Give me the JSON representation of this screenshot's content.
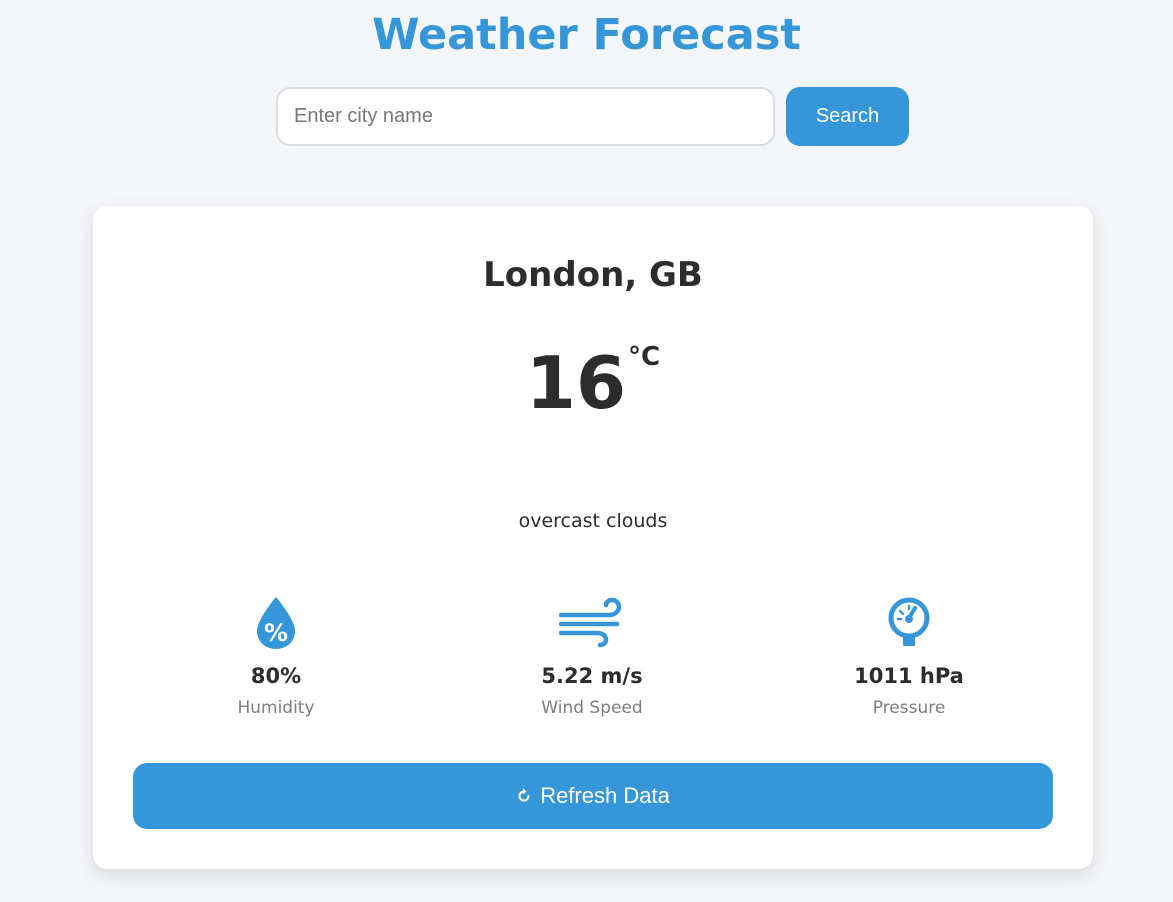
{
  "header": {
    "title": "Weather Forecast"
  },
  "search": {
    "placeholder": "Enter city name",
    "value": "",
    "button_label": "Search"
  },
  "weather": {
    "location": "London, GB",
    "temperature": "16",
    "unit": "°C",
    "description": "overcast clouds"
  },
  "stats": {
    "humidity": {
      "value": "80%",
      "label": "Humidity",
      "icon": "humidity-icon"
    },
    "wind": {
      "value": "5.22 m/s",
      "label": "Wind Speed",
      "icon": "wind-icon"
    },
    "pressure": {
      "value": "1011 hPa",
      "label": "Pressure",
      "icon": "pressure-gauge-icon"
    }
  },
  "actions": {
    "refresh_label": "Refresh Data",
    "refresh_icon": "refresh-icon"
  },
  "colors": {
    "accent": "#3597d9",
    "background": "#f4f6fa",
    "card": "#ffffff",
    "text": "#2c2c2c",
    "muted": "#7d7d7d"
  }
}
